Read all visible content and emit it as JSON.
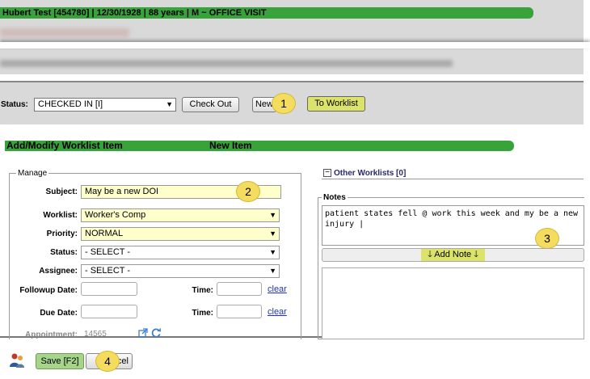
{
  "patient_header": {
    "text": "Hubert Test [454780] | 12/30/1928 | 88 years | M  ~  OFFICE VISIT",
    "obscured_line": "... ave ... dim ...  ma ... ce pho ... ss ... appoin ...",
    "bar_color": "#37a33a"
  },
  "status_bar": {
    "label": "Status:",
    "value": "CHECKED IN [I]",
    "buttons": {
      "check_out": "Check Out",
      "new": "New",
      "to_worklist": "To Worklist"
    }
  },
  "panel": {
    "title": "Add/Modify Worklist Item",
    "subtitle": "New Item"
  },
  "manage": {
    "legend": "Manage",
    "subject_label": "Subject:",
    "subject_value": "May be a new DOI",
    "worklist_label": "Worklist:",
    "worklist_value": "Worker's Comp",
    "priority_label": "Priority:",
    "priority_value": "NORMAL",
    "status_label": "Status:",
    "status_value": "- SELECT -",
    "assignee_label": "Assignee:",
    "assignee_value": "- SELECT -",
    "followup_label": "Followup Date:",
    "due_label": "Due Date:",
    "time_label": "Time:",
    "clear_label": "clear",
    "appointment_label": "Appointment:",
    "appointment_value": "14565"
  },
  "other_worklists": {
    "label": "Other Worklists [0]",
    "toggle": "−"
  },
  "notes": {
    "legend": "Notes",
    "text": "patient states fell @ work this week and my be a new\ninjury |",
    "add_note_label": "Add Note"
  },
  "footer": {
    "save_label": "Save [F2]",
    "cancel_label": "Cancel"
  },
  "callouts": [
    "1",
    "2",
    "3",
    "4"
  ],
  "colors": {
    "green_bar": "#37a33a",
    "highlight_yellow": "#dbe36a",
    "callout_yellow": "#f4dc5e",
    "field_yellow": "#ffffcc",
    "save_green": "#a6d48a"
  }
}
